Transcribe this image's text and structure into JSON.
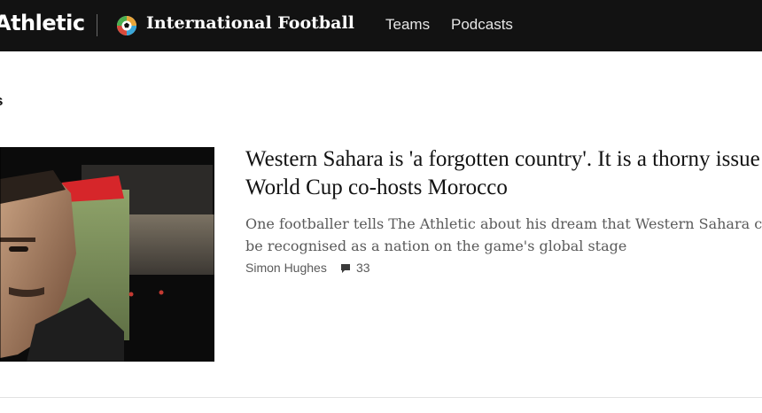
{
  "header": {
    "logo_text": "Athletic",
    "section_icon": "football-ball-icon",
    "section_title": "International Football",
    "nav": [
      {
        "label": "Teams"
      },
      {
        "label": "Podcasts"
      }
    ]
  },
  "main": {
    "sub_heading": "s",
    "article": {
      "headline": "Western Sahara is 'a forgotten country'. It is a thorny issue for World Cup co-hosts Morocco",
      "summary": "One footballer tells The Athletic about his dream that Western Sahara could be recognised as a nation on the game's global stage",
      "author": "Simon Hughes",
      "comment_icon": "comment-icon",
      "comment_count": "33"
    }
  },
  "colors": {
    "header_bg": "#121212",
    "text": "#121212",
    "muted": "#5a5a5a"
  }
}
